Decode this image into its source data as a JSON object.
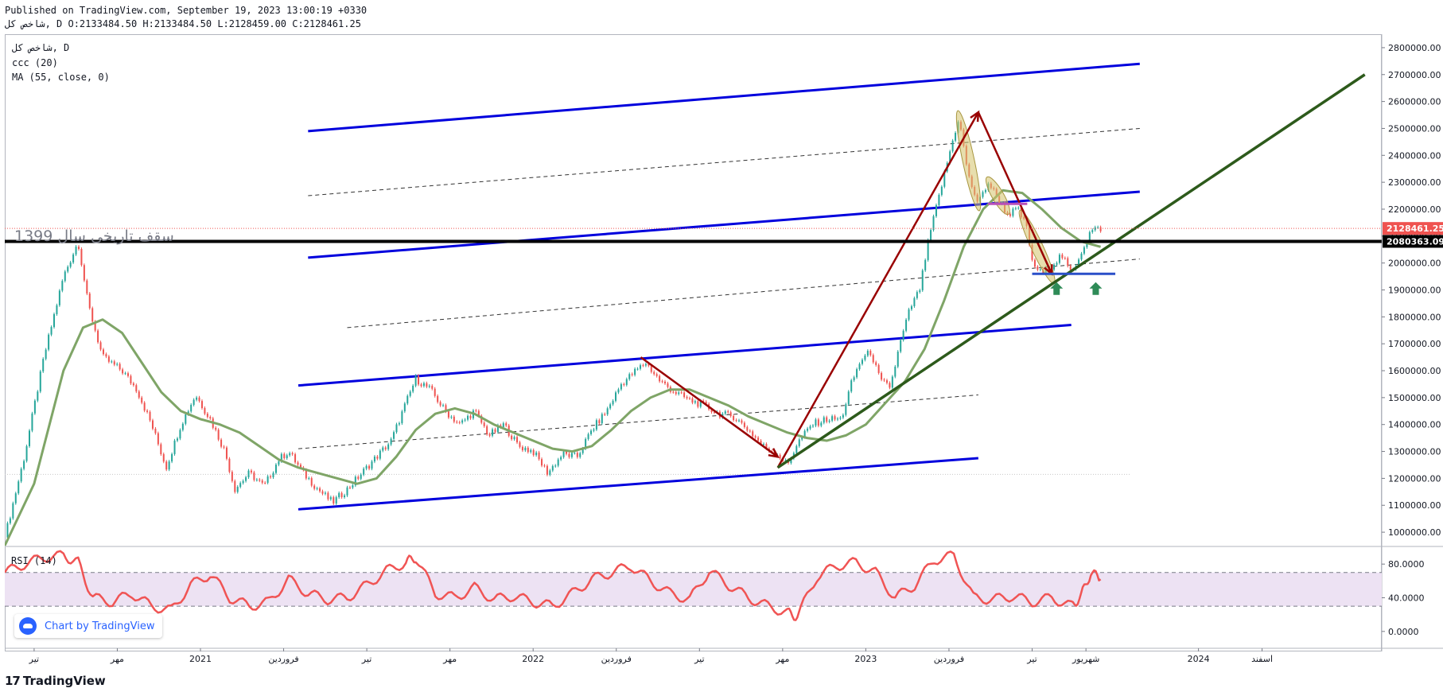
{
  "header": {
    "published": "Published on TradingView.com, September 19, 2023 13:00:19 +0330",
    "ohlc": "شاخص کل, D O:2133484.50 H:2133484.50 L:2128459.00 C:2128461.25"
  },
  "legend": {
    "symbol": "شاخص کل, D",
    "indicator1": "ccc (20)",
    "indicator2": "MA (55, close, 0)",
    "rsi": "RSI (14)"
  },
  "annotation_text": "سقف تاریخی سال 1399",
  "branding": {
    "chart_by": "Chart by TradingView",
    "logo": "TradingView",
    "logo_mark": "17"
  },
  "colors": {
    "up": "#26a69a",
    "down": "#ef5350",
    "ma": "#7fa567",
    "channel": "#0000dd",
    "trend": "#2d5a1b",
    "arrow": "#990000",
    "rsi_line": "#f05454",
    "rsi_band": "#ede2f3"
  },
  "chart_data": [
    {
      "type": "candlestick",
      "title": "",
      "ylim": [
        950000,
        2850000
      ],
      "y_ticks": [
        1000000,
        1100000,
        1200000,
        1300000,
        1400000,
        1500000,
        1600000,
        1700000,
        1800000,
        1900000,
        2000000,
        2100000,
        2200000,
        2300000,
        2400000,
        2500000,
        2600000,
        2700000,
        2800000
      ],
      "y_tick_labels": [
        "1000000.00",
        "1100000.00",
        "1200000.00",
        "1300000.00",
        "1400000.00",
        "1500000.00",
        "1600000.00",
        "1700000.00",
        "1800000.00",
        "1900000.00",
        "2000000.00",
        "2100000.00",
        "2200000.00",
        "2300000.00",
        "2400000.00",
        "2500000.00",
        "2600000.00",
        "2700000.00",
        "2800000.00"
      ],
      "x_labels": [
        {
          "label": "تیر",
          "t": 0.03
        },
        {
          "label": "مهر",
          "t": 0.115
        },
        {
          "label": "2021",
          "t": 0.2
        },
        {
          "label": "فروردین",
          "t": 0.285
        },
        {
          "label": "تیر",
          "t": 0.37
        },
        {
          "label": "مهر",
          "t": 0.455
        },
        {
          "label": "2022",
          "t": 0.54
        },
        {
          "label": "فروردین",
          "t": 0.625
        },
        {
          "label": "تیر",
          "t": 0.71
        },
        {
          "label": "مهر",
          "t": 0.795
        },
        {
          "label": "2023",
          "t": 0.88
        },
        {
          "label": "فروردین",
          "t": 0.965
        },
        {
          "label": "تیر",
          "t": 1.05
        },
        {
          "label": "شهریور",
          "t": 1.105
        },
        {
          "label": "2024",
          "t": 1.22
        },
        {
          "label": "اسفند",
          "t": 1.285
        }
      ],
      "close_series": [
        {
          "t": 0.0,
          "y": 980000
        },
        {
          "t": 0.02,
          "y": 1280000
        },
        {
          "t": 0.04,
          "y": 1650000
        },
        {
          "t": 0.06,
          "y": 1950000
        },
        {
          "t": 0.075,
          "y": 2080000
        },
        {
          "t": 0.085,
          "y": 1850000
        },
        {
          "t": 0.1,
          "y": 1650000
        },
        {
          "t": 0.12,
          "y": 1600000
        },
        {
          "t": 0.135,
          "y": 1530000
        },
        {
          "t": 0.15,
          "y": 1400000
        },
        {
          "t": 0.165,
          "y": 1240000
        },
        {
          "t": 0.18,
          "y": 1400000
        },
        {
          "t": 0.195,
          "y": 1510000
        },
        {
          "t": 0.21,
          "y": 1420000
        },
        {
          "t": 0.225,
          "y": 1300000
        },
        {
          "t": 0.235,
          "y": 1160000
        },
        {
          "t": 0.25,
          "y": 1220000
        },
        {
          "t": 0.265,
          "y": 1170000
        },
        {
          "t": 0.28,
          "y": 1270000
        },
        {
          "t": 0.29,
          "y": 1300000
        },
        {
          "t": 0.305,
          "y": 1220000
        },
        {
          "t": 0.32,
          "y": 1160000
        },
        {
          "t": 0.335,
          "y": 1110000
        },
        {
          "t": 0.35,
          "y": 1160000
        },
        {
          "t": 0.365,
          "y": 1220000
        },
        {
          "t": 0.38,
          "y": 1280000
        },
        {
          "t": 0.395,
          "y": 1340000
        },
        {
          "t": 0.41,
          "y": 1480000
        },
        {
          "t": 0.42,
          "y": 1570000
        },
        {
          "t": 0.435,
          "y": 1530000
        },
        {
          "t": 0.45,
          "y": 1450000
        },
        {
          "t": 0.465,
          "y": 1400000
        },
        {
          "t": 0.48,
          "y": 1450000
        },
        {
          "t": 0.495,
          "y": 1360000
        },
        {
          "t": 0.51,
          "y": 1400000
        },
        {
          "t": 0.525,
          "y": 1320000
        },
        {
          "t": 0.54,
          "y": 1300000
        },
        {
          "t": 0.555,
          "y": 1220000
        },
        {
          "t": 0.57,
          "y": 1290000
        },
        {
          "t": 0.585,
          "y": 1280000
        },
        {
          "t": 0.6,
          "y": 1380000
        },
        {
          "t": 0.615,
          "y": 1450000
        },
        {
          "t": 0.63,
          "y": 1550000
        },
        {
          "t": 0.645,
          "y": 1600000
        },
        {
          "t": 0.655,
          "y": 1630000
        },
        {
          "t": 0.67,
          "y": 1560000
        },
        {
          "t": 0.685,
          "y": 1520000
        },
        {
          "t": 0.7,
          "y": 1490000
        },
        {
          "t": 0.715,
          "y": 1470000
        },
        {
          "t": 0.73,
          "y": 1440000
        },
        {
          "t": 0.745,
          "y": 1430000
        },
        {
          "t": 0.76,
          "y": 1380000
        },
        {
          "t": 0.775,
          "y": 1320000
        },
        {
          "t": 0.79,
          "y": 1290000
        },
        {
          "t": 0.8,
          "y": 1250000
        },
        {
          "t": 0.81,
          "y": 1330000
        },
        {
          "t": 0.825,
          "y": 1400000
        },
        {
          "t": 0.84,
          "y": 1420000
        },
        {
          "t": 0.855,
          "y": 1420000
        },
        {
          "t": 0.865,
          "y": 1550000
        },
        {
          "t": 0.875,
          "y": 1640000
        },
        {
          "t": 0.885,
          "y": 1670000
        },
        {
          "t": 0.895,
          "y": 1560000
        },
        {
          "t": 0.905,
          "y": 1540000
        },
        {
          "t": 0.915,
          "y": 1700000
        },
        {
          "t": 0.925,
          "y": 1830000
        },
        {
          "t": 0.935,
          "y": 1900000
        },
        {
          "t": 0.945,
          "y": 2100000
        },
        {
          "t": 0.955,
          "y": 2250000
        },
        {
          "t": 0.965,
          "y": 2400000
        },
        {
          "t": 0.975,
          "y": 2540000
        },
        {
          "t": 0.985,
          "y": 2320000
        },
        {
          "t": 0.995,
          "y": 2220000
        },
        {
          "t": 1.005,
          "y": 2300000
        },
        {
          "t": 1.015,
          "y": 2240000
        },
        {
          "t": 1.025,
          "y": 2180000
        },
        {
          "t": 1.035,
          "y": 2200000
        },
        {
          "t": 1.045,
          "y": 2130000
        },
        {
          "t": 1.05,
          "y": 2000000
        },
        {
          "t": 1.06,
          "y": 1960000
        },
        {
          "t": 1.07,
          "y": 1990000
        },
        {
          "t": 1.08,
          "y": 2030000
        },
        {
          "t": 1.09,
          "y": 1960000
        },
        {
          "t": 1.1,
          "y": 2040000
        },
        {
          "t": 1.11,
          "y": 2120000
        },
        {
          "t": 1.12,
          "y": 2128461
        }
      ],
      "ma_series": [
        {
          "t": 0.0,
          "y": 950000
        },
        {
          "t": 0.03,
          "y": 1180000
        },
        {
          "t": 0.06,
          "y": 1600000
        },
        {
          "t": 0.08,
          "y": 1760000
        },
        {
          "t": 0.1,
          "y": 1790000
        },
        {
          "t": 0.12,
          "y": 1740000
        },
        {
          "t": 0.14,
          "y": 1630000
        },
        {
          "t": 0.16,
          "y": 1520000
        },
        {
          "t": 0.18,
          "y": 1450000
        },
        {
          "t": 0.2,
          "y": 1420000
        },
        {
          "t": 0.22,
          "y": 1400000
        },
        {
          "t": 0.24,
          "y": 1370000
        },
        {
          "t": 0.26,
          "y": 1320000
        },
        {
          "t": 0.28,
          "y": 1270000
        },
        {
          "t": 0.3,
          "y": 1240000
        },
        {
          "t": 0.33,
          "y": 1210000
        },
        {
          "t": 0.36,
          "y": 1180000
        },
        {
          "t": 0.38,
          "y": 1200000
        },
        {
          "t": 0.4,
          "y": 1280000
        },
        {
          "t": 0.42,
          "y": 1380000
        },
        {
          "t": 0.44,
          "y": 1440000
        },
        {
          "t": 0.46,
          "y": 1460000
        },
        {
          "t": 0.48,
          "y": 1440000
        },
        {
          "t": 0.5,
          "y": 1400000
        },
        {
          "t": 0.52,
          "y": 1370000
        },
        {
          "t": 0.54,
          "y": 1340000
        },
        {
          "t": 0.56,
          "y": 1310000
        },
        {
          "t": 0.58,
          "y": 1300000
        },
        {
          "t": 0.6,
          "y": 1320000
        },
        {
          "t": 0.62,
          "y": 1380000
        },
        {
          "t": 0.64,
          "y": 1450000
        },
        {
          "t": 0.66,
          "y": 1500000
        },
        {
          "t": 0.68,
          "y": 1530000
        },
        {
          "t": 0.7,
          "y": 1530000
        },
        {
          "t": 0.72,
          "y": 1500000
        },
        {
          "t": 0.74,
          "y": 1470000
        },
        {
          "t": 0.76,
          "y": 1430000
        },
        {
          "t": 0.78,
          "y": 1400000
        },
        {
          "t": 0.8,
          "y": 1370000
        },
        {
          "t": 0.82,
          "y": 1350000
        },
        {
          "t": 0.84,
          "y": 1340000
        },
        {
          "t": 0.86,
          "y": 1360000
        },
        {
          "t": 0.88,
          "y": 1400000
        },
        {
          "t": 0.9,
          "y": 1480000
        },
        {
          "t": 0.92,
          "y": 1560000
        },
        {
          "t": 0.94,
          "y": 1680000
        },
        {
          "t": 0.96,
          "y": 1860000
        },
        {
          "t": 0.98,
          "y": 2060000
        },
        {
          "t": 1.0,
          "y": 2200000
        },
        {
          "t": 1.02,
          "y": 2270000
        },
        {
          "t": 1.04,
          "y": 2260000
        },
        {
          "t": 1.06,
          "y": 2200000
        },
        {
          "t": 1.08,
          "y": 2130000
        },
        {
          "t": 1.1,
          "y": 2080000
        },
        {
          "t": 1.12,
          "y": 2060000
        }
      ],
      "last_price": {
        "value": 2128461.25,
        "label": "2128461.25",
        "color": "#ef5350"
      },
      "level": {
        "value": 2080363.09,
        "label": "2080363.09",
        "color": "#000000"
      },
      "drawings": {
        "channels": [
          {
            "solid": true,
            "a": {
              "t": 0.31,
              "y": 2490000
            },
            "b": {
              "t": 1.16,
              "y": 2740000
            }
          },
          {
            "solid": false,
            "a": {
              "t": 0.31,
              "y": 2250000
            },
            "b": {
              "t": 1.16,
              "y": 2500000
            }
          },
          {
            "solid": true,
            "a": {
              "t": 0.31,
              "y": 2020000
            },
            "b": {
              "t": 1.16,
              "y": 2265000
            }
          },
          {
            "solid": false,
            "a": {
              "t": 0.35,
              "y": 1760000
            },
            "b": {
              "t": 1.16,
              "y": 2015000
            }
          },
          {
            "solid": true,
            "a": {
              "t": 0.3,
              "y": 1545000
            },
            "b": {
              "t": 1.09,
              "y": 1770000
            }
          },
          {
            "solid": false,
            "a": {
              "t": 0.3,
              "y": 1310000
            },
            "b": {
              "t": 0.995,
              "y": 1510000
            }
          },
          {
            "solid": true,
            "a": {
              "t": 0.3,
              "y": 1085000
            },
            "b": {
              "t": 0.995,
              "y": 1275000
            }
          }
        ],
        "trendline": {
          "a": {
            "t": 0.79,
            "y": 1240000
          },
          "b": {
            "t": 1.39,
            "y": 2700000
          }
        },
        "arrows": [
          {
            "a": {
              "t": 0.65,
              "y": 1650000
            },
            "b": {
              "t": 0.79,
              "y": 1280000
            }
          },
          {
            "a": {
              "t": 0.79,
              "y": 1240000
            },
            "b": {
              "t": 0.995,
              "y": 2560000
            }
          },
          {
            "a": {
              "t": 0.995,
              "y": 2560000
            },
            "b": {
              "t": 1.07,
              "y": 1960000
            }
          }
        ],
        "ellipses": [
          {
            "t": 0.985,
            "y": 2380000,
            "rt": 0.006,
            "ry": 190000,
            "rot": -12
          },
          {
            "t": 1.015,
            "y": 2250000,
            "rt": 0.006,
            "ry": 80000,
            "rot": -30
          },
          {
            "t": 1.055,
            "y": 2060000,
            "rt": 0.006,
            "ry": 150000,
            "rot": -25
          }
        ],
        "support": {
          "a": {
            "t": 1.05,
            "y": 1960000
          },
          "b": {
            "t": 1.135,
            "y": 1960000
          }
        },
        "up_arrows": [
          {
            "t": 1.075,
            "y": 1905000
          },
          {
            "t": 1.115,
            "y": 1905000
          }
        ]
      }
    },
    {
      "type": "line",
      "title": "",
      "ylim": [
        -20,
        100
      ],
      "y_ticks": [
        0,
        40,
        80
      ],
      "y_tick_labels": [
        "0.0000",
        "40.0000",
        "80.0000"
      ],
      "band": [
        30,
        70
      ],
      "series": [
        {
          "values_t": [
            0,
            0.02,
            0.04,
            0.06,
            0.075,
            0.09,
            0.11,
            0.13,
            0.15,
            0.17,
            0.19,
            0.21,
            0.23,
            0.25,
            0.27,
            0.29,
            0.31,
            0.33,
            0.35,
            0.37,
            0.39,
            0.41,
            0.42,
            0.44,
            0.46,
            0.48,
            0.5,
            0.52,
            0.54,
            0.56,
            0.58,
            0.6,
            0.62,
            0.64,
            0.66,
            0.68,
            0.7,
            0.72,
            0.74,
            0.76,
            0.78,
            0.8,
            0.81,
            0.83,
            0.85,
            0.87,
            0.89,
            0.91,
            0.93,
            0.95,
            0.97,
            0.99,
            1.01,
            1.03,
            1.05,
            1.07,
            1.09,
            1.1,
            1.11,
            1.12
          ],
          "values": [
            70,
            80,
            88,
            90,
            82,
            40,
            35,
            45,
            30,
            25,
            55,
            68,
            40,
            30,
            35,
            62,
            45,
            38,
            40,
            55,
            72,
            82,
            88,
            45,
            40,
            52,
            38,
            42,
            35,
            30,
            45,
            62,
            70,
            78,
            60,
            45,
            38,
            72,
            55,
            40,
            30,
            22,
            18,
            65,
            78,
            82,
            70,
            40,
            55,
            85,
            90,
            40,
            38,
            42,
            35,
            40,
            30,
            42,
            70,
            62
          ]
        }
      ]
    }
  ]
}
